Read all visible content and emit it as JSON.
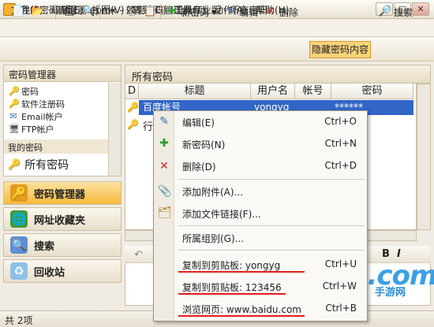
{
  "window": {
    "title": "我的密码管理器.epmx - 效能密码管理器专业版 - 所有密码",
    "min": "–",
    "max": "□",
    "close": "✕"
  },
  "menu": [
    {
      "label": "文件(F)"
    },
    {
      "label": "编辑(E)"
    },
    {
      "label": "视图(V)"
    },
    {
      "label": "转到(G)"
    },
    {
      "label": "工具(T)"
    },
    {
      "label": "动作(A)"
    },
    {
      "label": "帮助(H)"
    }
  ],
  "toolbar": {
    "new_password": "新密码",
    "edit": "编辑",
    "delete": "删除",
    "hide_password": "隐藏密码内容",
    "search": "搜索"
  },
  "left": {
    "header": "密码管理器",
    "tree": [
      {
        "label": "密码",
        "icon": "key-icon"
      },
      {
        "label": "软件注册码",
        "icon": "key-icon"
      },
      {
        "label": "Email帐户",
        "icon": "email-icon"
      },
      {
        "label": "FTP帐户",
        "icon": "ftp-icon"
      }
    ],
    "group": "我的密码",
    "all": "所有密码",
    "nav": [
      {
        "label": "密码管理器",
        "active": true
      },
      {
        "label": "网址收藏夹"
      },
      {
        "label": "搜索"
      },
      {
        "label": "回收站"
      }
    ]
  },
  "right": {
    "header": "所有密码",
    "columns": [
      "D",
      "标题",
      "用户名",
      "帐号",
      "密码"
    ],
    "rows": [
      {
        "title": "百度帐号",
        "user": "yongyg",
        "account": "",
        "password": "******"
      },
      {
        "title": "行",
        "user": "",
        "account": "",
        "password": ""
      }
    ]
  },
  "context_menu": [
    {
      "label": "编辑(E)",
      "shortcut": "Ctrl+O",
      "icon": "edit-icon"
    },
    {
      "label": "新密码(N)",
      "shortcut": "Ctrl+N",
      "icon": "plus-icon"
    },
    {
      "label": "删除(D)",
      "shortcut": "Ctrl+D",
      "icon": "delete-icon"
    },
    {
      "label": "添加附件(A)...",
      "shortcut": "",
      "icon": "paperclip-icon"
    },
    {
      "label": "添加文件链接(F)...",
      "shortcut": "",
      "icon": "file-link-icon"
    },
    {
      "label": "所属组别(G)...",
      "shortcut": "",
      "icon": ""
    },
    {
      "label": "复制到剪贴板: yongyg",
      "shortcut": "Ctrl+U",
      "icon": ""
    },
    {
      "label": "复制到剪贴板: 123456",
      "shortcut": "Ctrl+W",
      "icon": ""
    },
    {
      "label": "浏览网页: www.baidu.com",
      "shortcut": "Ctrl+B",
      "icon": ""
    }
  ],
  "status": "共 2项",
  "watermark": {
    "main": "2R9.com",
    "sub": "手游网"
  },
  "colors": {
    "accent": "#f6b93c",
    "selection": "#3166c7",
    "annotation": "#e3201b"
  }
}
